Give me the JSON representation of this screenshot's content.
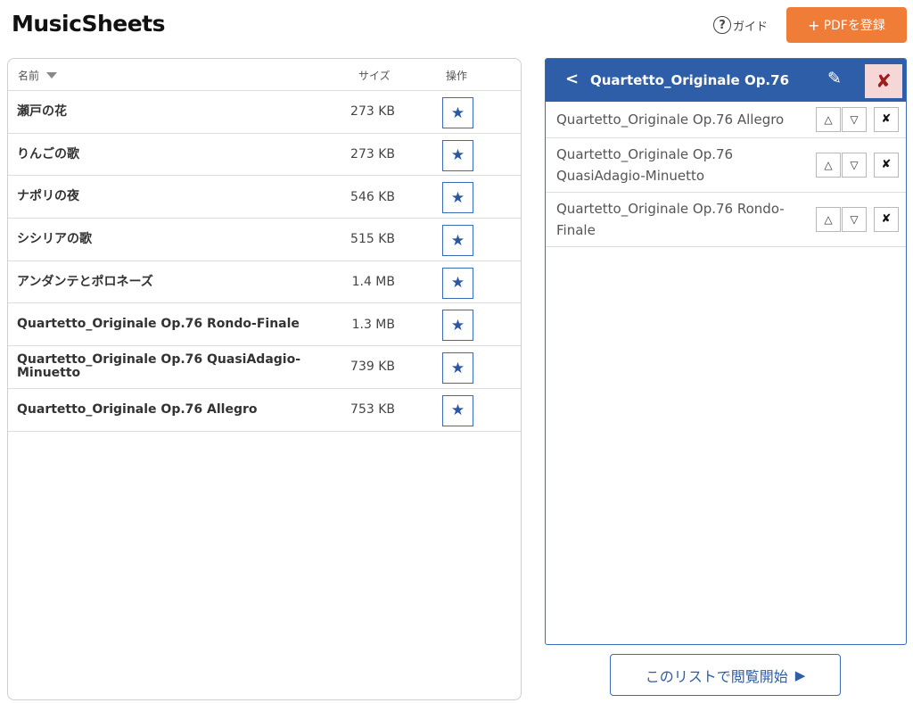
{
  "app": {
    "title": "MusicSheets"
  },
  "header": {
    "guide_label": "ガイド",
    "guide_icon": "?",
    "add_pdf_plus": "+",
    "add_pdf_label": "PDFを登録",
    "add_pdf_color": "#ef7d37"
  },
  "file_table": {
    "columns": {
      "name": "名前",
      "size": "サイズ",
      "actions": "操作"
    },
    "star_glyph": "★",
    "rows": [
      {
        "name": "瀬戸の花",
        "size": "273 KB"
      },
      {
        "name": "りんごの歌",
        "size": "273 KB"
      },
      {
        "name": "ナポリの夜",
        "size": "546 KB"
      },
      {
        "name": "シシリアの歌",
        "size": "515 KB"
      },
      {
        "name": "アンダンテとポロネーズ",
        "size": "1.4 MB"
      },
      {
        "name": "Quartetto_Originale Op.76 Rondo-Finale",
        "size": "1.3 MB"
      },
      {
        "name": "Quartetto_Originale Op.76 QuasiAdagio-Minuetto",
        "size": "739 KB"
      },
      {
        "name": "Quartetto_Originale Op.76 Allegro",
        "size": "753 KB"
      }
    ]
  },
  "playlist": {
    "back_glyph": "<",
    "title": "Quartetto_Originale Op.76",
    "edit_glyph": "✎",
    "close_glyph": "✘",
    "accent_color": "#2f5ea8",
    "up_glyph": "△",
    "down_glyph": "▽",
    "remove_glyph": "✘",
    "items": [
      {
        "name": "Quartetto_Originale Op.76 Allegro"
      },
      {
        "name": "Quartetto_Originale Op.76 QuasiAdagio-Minuetto"
      },
      {
        "name": "Quartetto_Originale Op.76 Rondo-Finale"
      }
    ]
  },
  "start_button": {
    "label": "このリストで閲覧開始",
    "glyph": "▶"
  }
}
